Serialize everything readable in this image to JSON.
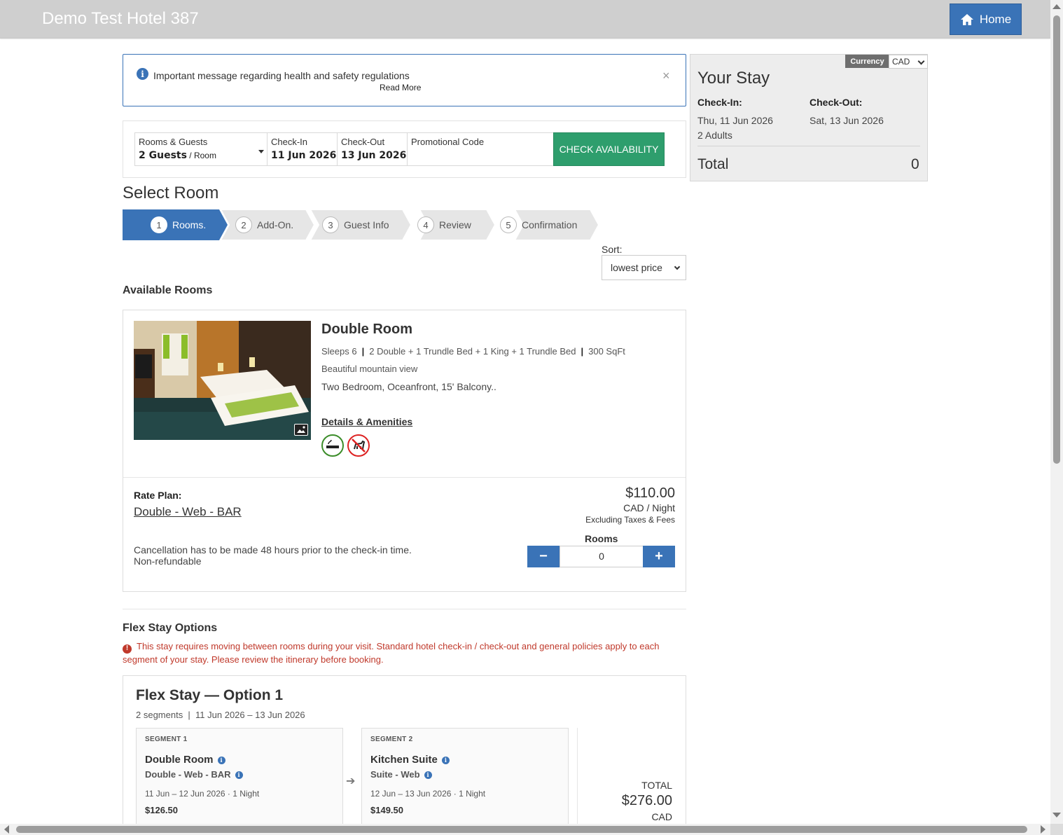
{
  "header": {
    "hotel_name": "Demo Test Hotel 387",
    "home_label": "Home"
  },
  "notice": {
    "message": "Important message regarding health and safety regulations",
    "read_more": "Read More",
    "close": "×"
  },
  "search": {
    "rooms_guests_label": "Rooms & Guests",
    "rooms_guests_value": "2 Guests",
    "rooms_guests_suffix": " / Room",
    "checkin_label": "Check-In",
    "checkin_value": "11 Jun 2026",
    "checkout_label": "Check-Out",
    "checkout_value": "13 Jun 2026",
    "promo_label": "Promotional Code",
    "promo_value": "",
    "check_button": "CHECK AVAILABILITY"
  },
  "stay": {
    "currency_label": "Currency",
    "currency_value": "CAD",
    "title": "Your Stay",
    "checkin_label": "Check-In:",
    "checkout_label": "Check-Out:",
    "checkin_value": "Thu, 11 Jun 2026",
    "checkout_value": "Sat, 13 Jun 2026",
    "adults": "2 Adults",
    "total_label": "Total",
    "total_value": "0"
  },
  "steps": {
    "title": "Select Room",
    "items": [
      {
        "num": "1",
        "label": "Rooms."
      },
      {
        "num": "2",
        "label": "Add-On."
      },
      {
        "num": "3",
        "label": "Guest Info"
      },
      {
        "num": "4",
        "label": "Review"
      },
      {
        "num": "5",
        "label": "Confirmation"
      }
    ]
  },
  "sort": {
    "label": "Sort:",
    "value": "lowest price"
  },
  "available_title": "Available Rooms",
  "room": {
    "name": "Double Room",
    "sleeps": "Sleeps 6",
    "beds": "2 Double + 1 Trundle Bed + 1 King + 1 Trundle Bed",
    "size": "300 SqFt",
    "view": "Beautiful mountain view",
    "description": "Two Bedroom, Oceanfront, 15' Balcony..",
    "details_link": "Details & Amenities",
    "rate_label": "Rate Plan:",
    "rate_name": "Double - Web - BAR",
    "price": "$110.00",
    "price_unit": "CAD / Night",
    "price_excl": "Excluding Taxes & Fees",
    "rooms_label": "Rooms",
    "qty": "0",
    "minus": "−",
    "plus": "+",
    "cancel_line1": "Cancellation has to be made 48 hours prior to the check-in time.",
    "cancel_line2": "Non-refundable"
  },
  "flex": {
    "title": "Flex Stay Options",
    "warning": "This stay requires moving between rooms during your visit. Standard hotel check-in / check-out and general policies apply to each segment of your stay. Please review the itinerary before booking.",
    "option_name": "Flex Stay — Option 1",
    "segments_count": "2 segments",
    "date_range": "11 Jun 2026 – 13 Jun 2026",
    "segments": [
      {
        "label": "SEGMENT 1",
        "room": "Double Room",
        "rate": "Double - Web - BAR",
        "dates": "11 Jun – 12 Jun 2026 · 1 Night",
        "price": "$126.50"
      },
      {
        "label": "SEGMENT 2",
        "room": "Kitchen Suite",
        "rate": "Suite - Web",
        "dates": "12 Jun – 13 Jun 2026 · 1 Night",
        "price": "$149.50"
      }
    ],
    "arrow": "➔",
    "total_label": "TOTAL",
    "total_value": "$276.00",
    "total_currency": "CAD"
  },
  "colors": {
    "primary": "#3a73b7",
    "success": "#2e9e6d",
    "warning": "#c0392b",
    "header_bg": "#cfcfcf"
  }
}
